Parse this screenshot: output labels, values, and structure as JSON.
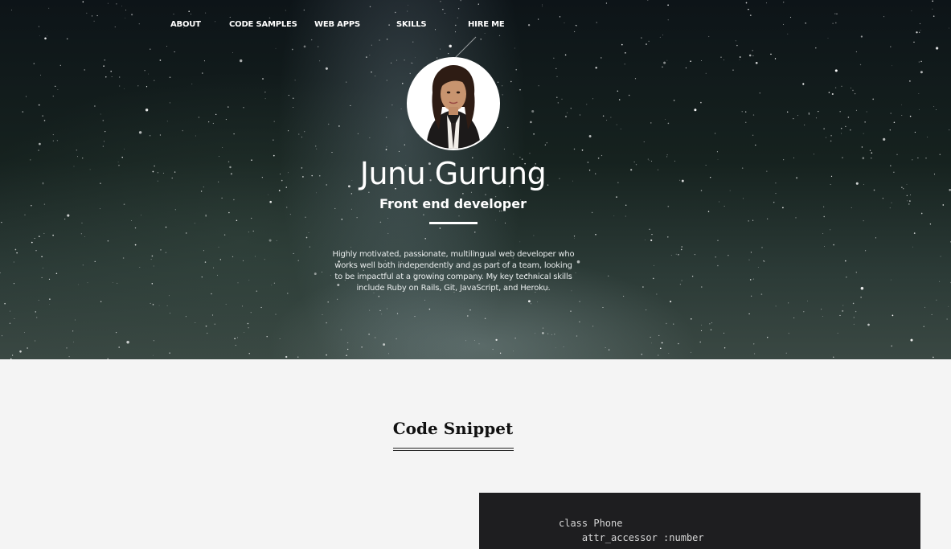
{
  "nav": {
    "items": [
      {
        "label": "ABOUT"
      },
      {
        "label": "CODE SAMPLES"
      },
      {
        "label": "WEB APPS"
      },
      {
        "label": "SKILLS"
      },
      {
        "label": "HIRE ME"
      }
    ]
  },
  "profile": {
    "name": "Junu Gurung",
    "role": "Front end developer",
    "bio": "Highly motivated, passionate, multilingual web developer who works well both independently and as part of a team, looking to be impactful at a growing company. My key technical skills include Ruby on Rails, Git, JavaScript, and Heroku."
  },
  "code_section": {
    "title": "Code Snippet",
    "lines": [
      "class Phone",
      "    attr_accessor :number"
    ]
  },
  "colors": {
    "page_background": "#f4f4f4",
    "code_background": "#1e1e20",
    "hero_text": "#ffffff"
  }
}
